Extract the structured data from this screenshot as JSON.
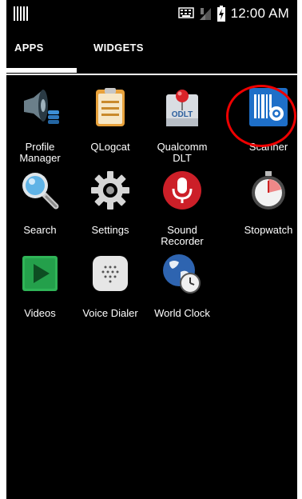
{
  "status_bar": {
    "time": "12:00 AM"
  },
  "tabs": [
    {
      "label": "APPS"
    },
    {
      "label": "WIDGETS"
    }
  ],
  "apps": [
    {
      "label": "Profile Manager",
      "icon": "profile-manager-icon"
    },
    {
      "label": "QLogcat",
      "icon": "qlogcat-icon"
    },
    {
      "label": "Qualcomm DLT",
      "icon": "qualcomm-dlt-icon"
    },
    {
      "label": "Scanner",
      "icon": "scanner-icon"
    },
    {
      "label": "Search",
      "icon": "search-icon"
    },
    {
      "label": "Settings",
      "icon": "settings-gear-icon"
    },
    {
      "label": "Sound Recorder",
      "icon": "microphone-icon"
    },
    {
      "label": "Stopwatch",
      "icon": "stopwatch-icon"
    },
    {
      "label": "Videos",
      "icon": "play-icon"
    },
    {
      "label": "Voice Dialer",
      "icon": "voice-dialer-icon"
    },
    {
      "label": "World Clock",
      "icon": "globe-clock-icon"
    }
  ],
  "icon_text": {
    "dlt_logo": "ODLT"
  },
  "colors": {
    "highlight": "#e00000",
    "background": "#000000"
  }
}
